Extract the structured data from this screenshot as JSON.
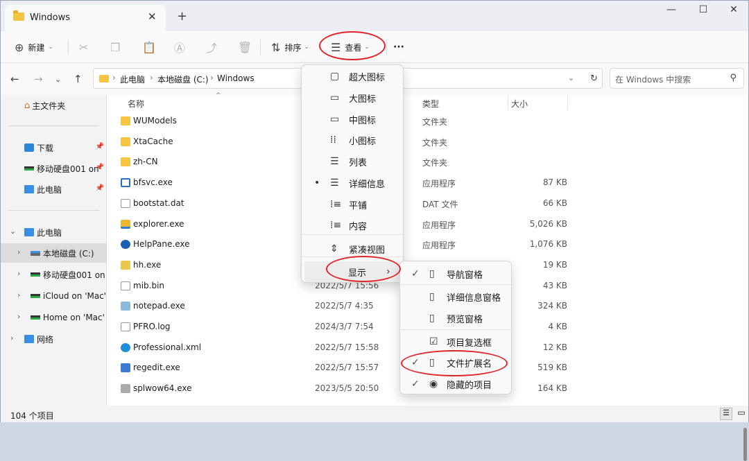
{
  "window": {
    "tab_title": "Windows",
    "minimize": "—",
    "maximize": "☐",
    "close": "✕",
    "new_tab": "+",
    "tab_close": "✕"
  },
  "toolbar": {
    "new_label": "新建",
    "sort_label": "排序",
    "view_label": "查看",
    "more_label": "···"
  },
  "address": {
    "crumbs": [
      "此电脑",
      "本地磁盘 (C:)",
      "Windows"
    ],
    "search_placeholder": "在 Windows 中搜索"
  },
  "sidebar": {
    "home": "主文件夹",
    "downloads": "下载",
    "portable": "移动硬盘001 on",
    "thispc_pinned": "此电脑",
    "thispc": "此电脑",
    "local_c": "本地磁盘 (C:)",
    "portable2": "移动硬盘001 on 'I",
    "icloud": "iCloud on 'Mac' (",
    "home_mac": "Home on 'Mac' (",
    "network": "网络"
  },
  "columns": {
    "name": "名称",
    "type": "类型",
    "size": "大小"
  },
  "files": [
    {
      "name": "WUModels",
      "date": "",
      "type": "文件夹",
      "size": ""
    },
    {
      "name": "XtaCache",
      "date": "",
      "type": "文件夹",
      "size": ""
    },
    {
      "name": "zh-CN",
      "date": "",
      "type": "文件夹",
      "size": ""
    },
    {
      "name": "bfsvc.exe",
      "date": "",
      "type": "应用程序",
      "size": "87 KB"
    },
    {
      "name": "bootstat.dat",
      "date": "",
      "type": "DAT 文件",
      "size": "66 KB"
    },
    {
      "name": "explorer.exe",
      "date": "",
      "type": "应用程序",
      "size": "5,026 KB"
    },
    {
      "name": "HelpPane.exe",
      "date": "",
      "type": "应用程序",
      "size": "1,076 KB"
    },
    {
      "name": "hh.exe",
      "date": "",
      "type": "",
      "size": "19 KB"
    },
    {
      "name": "mib.bin",
      "date": "2022/5/7 15:56",
      "type": "",
      "size": "43 KB"
    },
    {
      "name": "notepad.exe",
      "date": "2022/5/7 4:35",
      "type": "",
      "size": "324 KB"
    },
    {
      "name": "PFRO.log",
      "date": "2024/3/7 7:54",
      "type": "",
      "size": "4 KB"
    },
    {
      "name": "Professional.xml",
      "date": "2022/5/7 15:58",
      "type": "",
      "size": "12 KB"
    },
    {
      "name": "regedit.exe",
      "date": "2022/5/7 15:57",
      "type": "",
      "size": "519 KB"
    },
    {
      "name": "splwow64.exe",
      "date": "2023/5/5 20:50",
      "type": "",
      "size": "164 KB"
    }
  ],
  "status": {
    "count": "104 个项目"
  },
  "view_menu": {
    "items": [
      "超大图标",
      "大图标",
      "中图标",
      "小图标",
      "列表",
      "详细信息",
      "平铺",
      "内容",
      "紧凑视图",
      "显示"
    ],
    "selected_bullet": "•",
    "submenu_arrow": "›"
  },
  "show_menu": {
    "items": [
      "导航窗格",
      "详细信息窗格",
      "预览窗格",
      "项目复选框",
      "文件扩展名",
      "隐藏的项目"
    ],
    "check": "✓"
  },
  "colors": {
    "accent": "#0067c0",
    "annotation": "#e0242a",
    "folder": "#f6c443"
  }
}
